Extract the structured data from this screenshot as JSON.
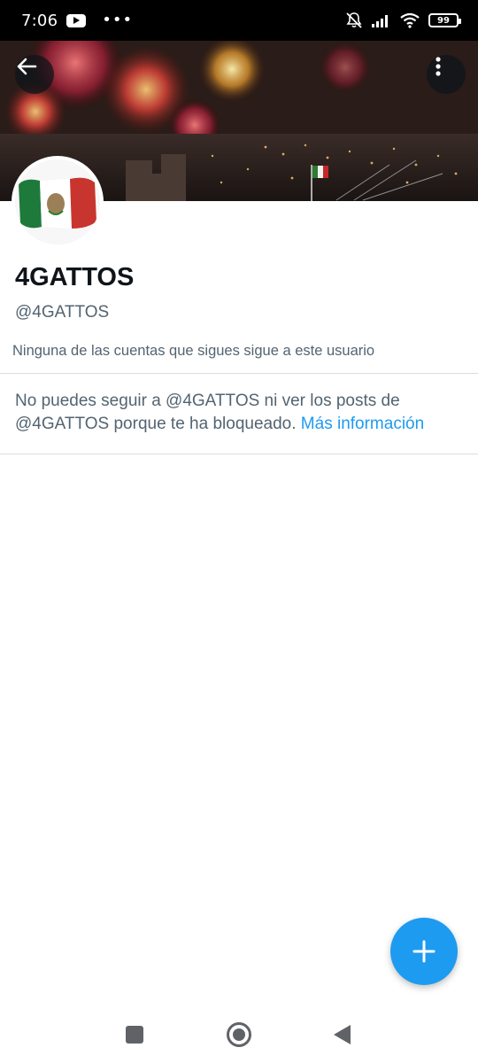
{
  "status_bar": {
    "time": "7:06",
    "battery": "99",
    "icons": [
      "youtube-icon",
      "more-dots-icon",
      "muted-bell-icon",
      "signal-icon",
      "wifi-icon",
      "battery-icon"
    ]
  },
  "header": {
    "back_icon": "back-arrow-icon",
    "menu_icon": "more-vertical-icon",
    "banner": "fireworks-over-city-plaza"
  },
  "profile": {
    "avatar": "mexican-flag",
    "display_name": "4GATTOS",
    "handle": "@4GATTOS",
    "followers_note": "Ninguna de las cuentas que sigues sigue a este usuario"
  },
  "blocked_notice": {
    "text": "No puedes seguir a @4GATTOS ni ver los posts de @4GATTOS porque te ha bloqueado. ",
    "link_label": "Más información"
  },
  "fab": {
    "icon": "plus-icon"
  },
  "nav_bar": {
    "icons": [
      "recents-square-icon",
      "home-circle-icon",
      "back-triangle-icon"
    ]
  },
  "colors": {
    "accent": "#1d9bf0",
    "text_primary": "#0f1419",
    "text_secondary": "#536471",
    "divider": "#d9dde0"
  }
}
